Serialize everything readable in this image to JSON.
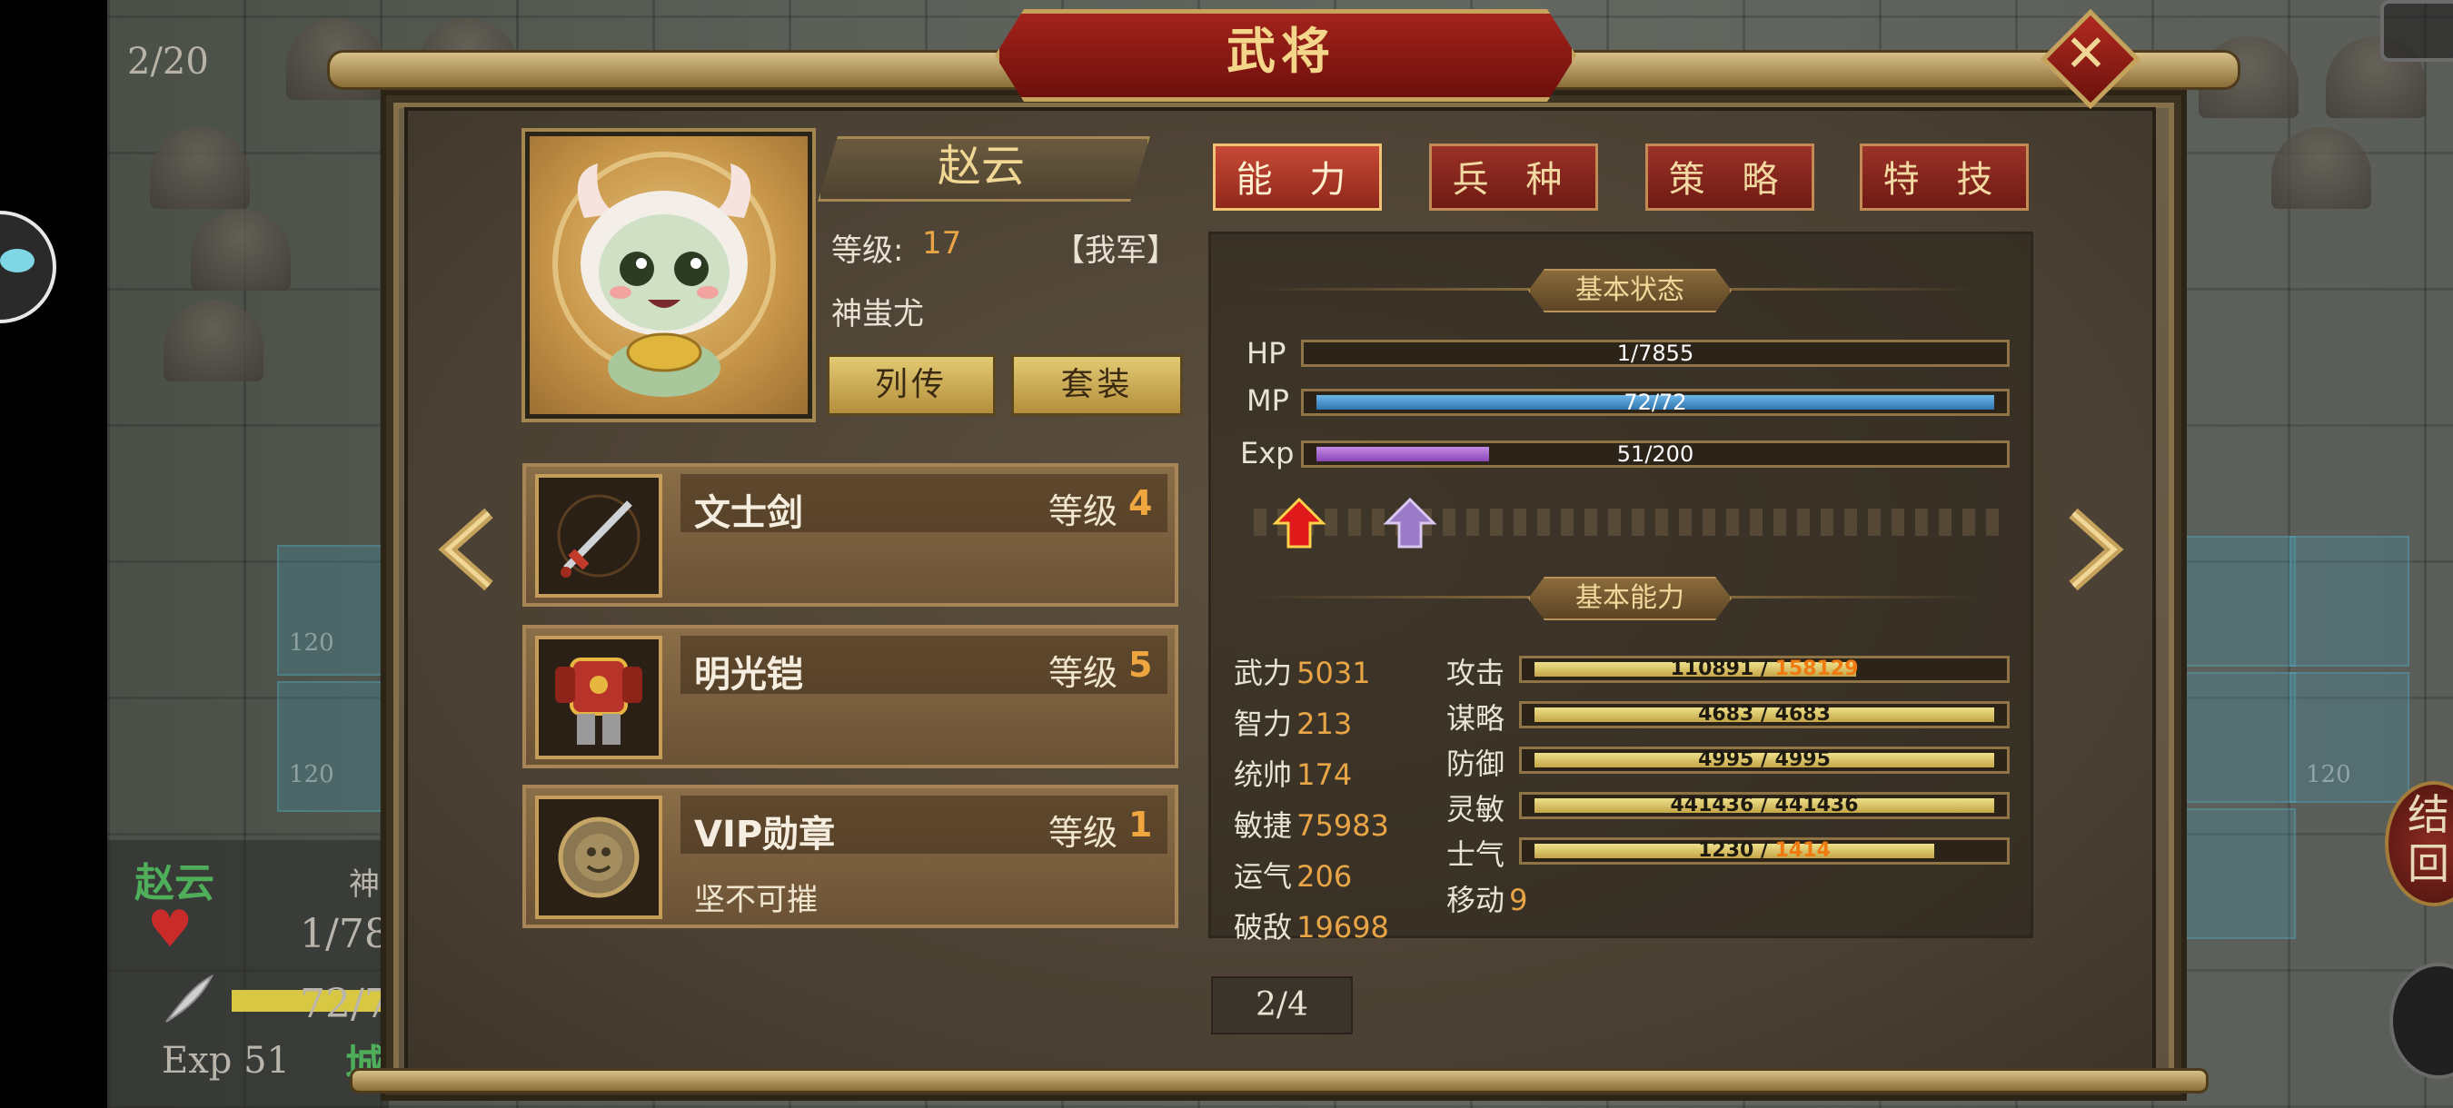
{
  "screen": {
    "turn_counter": "2/20",
    "dialog_title": "武将",
    "page_indicator": "2/4"
  },
  "hero": {
    "name": "赵云",
    "level_label": "等级:",
    "level": "17",
    "faction": "【我军】",
    "title": "神蚩尤",
    "buttons": {
      "bio": "列传",
      "set": "套装"
    }
  },
  "equipment": [
    {
      "name": "文士剑",
      "level_label": "等级",
      "level": "4",
      "desc": "",
      "icon": "sword-icon"
    },
    {
      "name": "明光铠",
      "level_label": "等级",
      "level": "5",
      "desc": "",
      "icon": "armor-icon"
    },
    {
      "name": "VIP勋章",
      "level_label": "等级",
      "level": "1",
      "desc": "坚不可摧",
      "icon": "medal-icon"
    }
  ],
  "tabs": [
    "能 力",
    "兵 种",
    "策 略",
    "特 技"
  ],
  "status": {
    "section_title": "基本状态",
    "hp_label": "HP",
    "hp": "1/7855",
    "hp_fraction": 0.0001,
    "mp_label": "MP",
    "mp": "72/72",
    "mp_fraction": 1.0,
    "exp_label": "Exp",
    "exp": "51/200",
    "exp_fraction": 0.255
  },
  "ability": {
    "section_title": "基本能力",
    "left": [
      {
        "name": "武力",
        "value": "5031"
      },
      {
        "name": "智力",
        "value": "213"
      },
      {
        "name": "统帅",
        "value": "174"
      },
      {
        "name": "敏捷",
        "value": "75983"
      },
      {
        "name": "运气",
        "value": "206"
      },
      {
        "name": "破敌",
        "value": "19698"
      }
    ],
    "right": [
      {
        "name": "攻击",
        "base": "110891",
        "sep": " / ",
        "total": "158129",
        "highlight": true,
        "fraction": 0.7
      },
      {
        "name": "谋略",
        "base": "4683",
        "sep": " / ",
        "total": "4683",
        "highlight": false,
        "fraction": 1.0
      },
      {
        "name": "防御",
        "base": "4995",
        "sep": " / ",
        "total": "4995",
        "highlight": false,
        "fraction": 1.0
      },
      {
        "name": "灵敏",
        "base": "441436",
        "sep": " / ",
        "total": "441436",
        "highlight": false,
        "fraction": 1.0
      },
      {
        "name": "士气",
        "base": "1230",
        "sep": " / ",
        "total": "1414",
        "highlight": true,
        "fraction": 0.87
      }
    ],
    "move_label": "移动",
    "move_value": "9"
  },
  "battle_unit": {
    "name": "赵云",
    "hp": "1/78",
    "mp": "72/7",
    "exp": "Exp 51",
    "city": "城",
    "tag": "神"
  },
  "side_button": "结\n回",
  "map_tile_number": "120",
  "colors": {
    "accent_gold": "#e9a545",
    "tab_red": "#9b3228",
    "mp_blue": "#3f8fc9",
    "exp_purple": "#9b5bc7",
    "stat_bar_gold": "#d9c26a",
    "highlight_orange": "#f07a12"
  }
}
